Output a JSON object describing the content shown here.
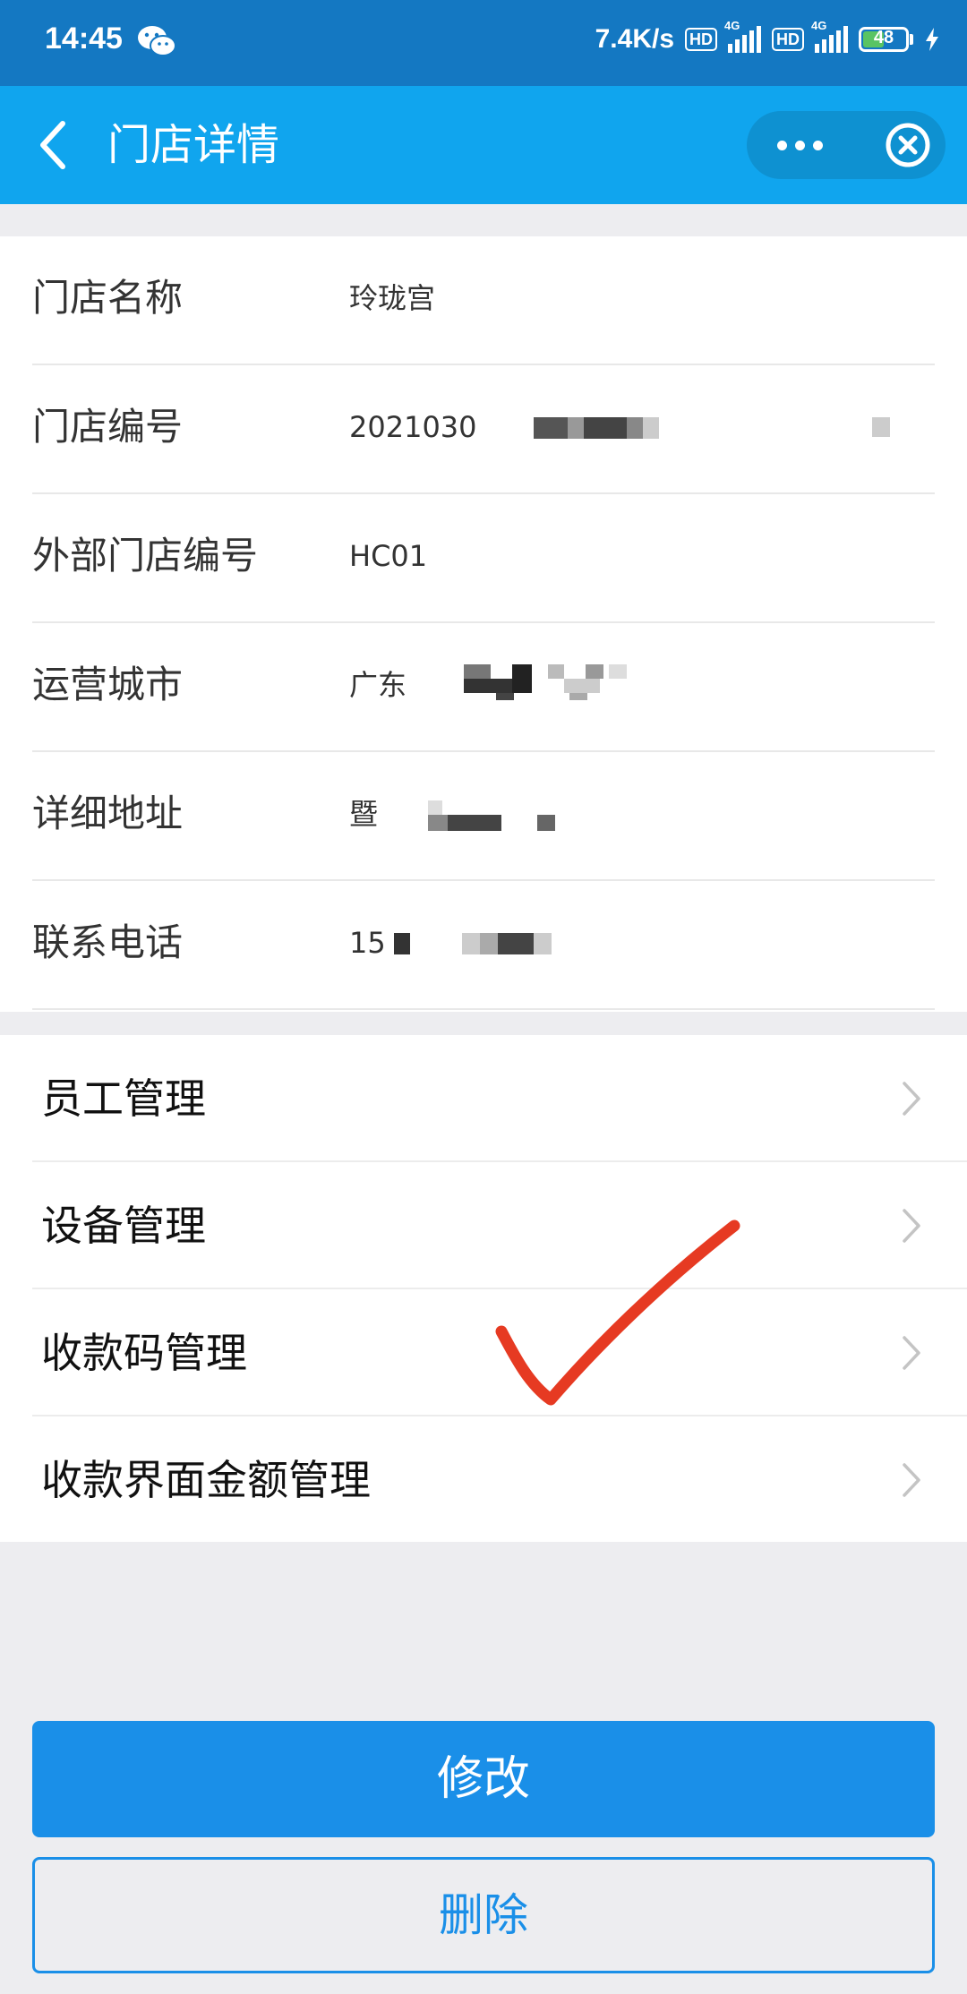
{
  "status_bar": {
    "time": "14:45",
    "network_speed": "7.4K/s",
    "hd_badge": "HD",
    "network_type": "4G",
    "battery_level": "48",
    "icons": [
      "wechat-icon",
      "signal-icon",
      "battery-icon",
      "charging-icon"
    ]
  },
  "navbar": {
    "title": "门店详情",
    "icons": [
      "back-icon",
      "more-icon",
      "close-icon"
    ]
  },
  "store_info": {
    "rows": [
      {
        "label": "门店名称",
        "value": "玲珑宫"
      },
      {
        "label": "门店编号",
        "value": "2021030"
      },
      {
        "label": "外部门店编号",
        "value": "HC01"
      },
      {
        "label": "运营城市",
        "value": "广东"
      },
      {
        "label": "详细地址",
        "value": "暨"
      },
      {
        "label": "联系电话",
        "value": "15"
      }
    ]
  },
  "menu": {
    "items": [
      {
        "label": "员工管理"
      },
      {
        "label": "设备管理"
      },
      {
        "label": "收款码管理"
      },
      {
        "label": "收款界面金额管理"
      }
    ]
  },
  "actions": {
    "edit_label": "修改",
    "delete_label": "删除"
  },
  "colors": {
    "status_bar": "#1478c2",
    "navbar": "#10a5ee",
    "primary": "#1a8fe8",
    "annotation_mark": "#e63a22"
  }
}
